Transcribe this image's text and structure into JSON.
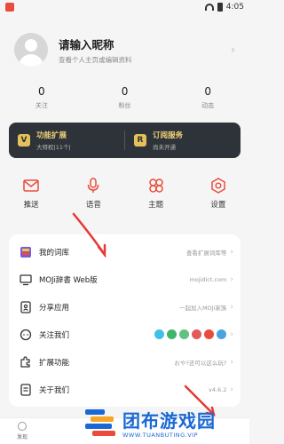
{
  "status": {
    "time": "4:05"
  },
  "profile": {
    "nickname_prompt": "请输入昵称",
    "subtitle": "查看个人主页或编辑资料"
  },
  "stats": [
    {
      "value": "0",
      "label": "关注"
    },
    {
      "value": "0",
      "label": "粉丝"
    },
    {
      "value": "0",
      "label": "动态"
    }
  ],
  "promo": {
    "left": {
      "title": "功能扩展",
      "sub": "大特权|11个|",
      "icon": "V"
    },
    "right": {
      "title": "订阅服务",
      "sub": "尚未开通",
      "icon": "R"
    }
  },
  "quick_actions": [
    {
      "label": "推送",
      "icon": "mail-icon"
    },
    {
      "label": "语音",
      "icon": "mic-icon"
    },
    {
      "label": "主题",
      "icon": "clover-icon"
    },
    {
      "label": "设置",
      "icon": "gear-icon"
    }
  ],
  "menu": [
    {
      "label": "我的词库",
      "hint": "查看扩展词库等",
      "icon": "book-icon"
    },
    {
      "label": "MOJi辞書 Web版",
      "hint": "mojidict.com",
      "icon": "monitor-icon"
    },
    {
      "label": "分享应用",
      "hint": "一起加入MOJi家族",
      "icon": "share-icon"
    },
    {
      "label": "关注我们",
      "hint": "",
      "icon": "chat-icon"
    },
    {
      "label": "扩展功能",
      "hint": "",
      "icon": "puzzle-icon"
    },
    {
      "label": "关于我们",
      "hint": "v4.6.2",
      "icon": "info-icon"
    }
  ],
  "menu_extension_hint": "",
  "colors": {
    "accent": "#e94c3d",
    "promo_bg": "#2d3338",
    "gold": "#f0d27a",
    "watermark": "#1a68d6"
  },
  "bottom_nav": [
    {
      "label": "发现"
    },
    {
      "label": ""
    }
  ],
  "watermark": {
    "cn": "团布游戏园",
    "en": "WWW.TUANBUTING.VIP"
  }
}
